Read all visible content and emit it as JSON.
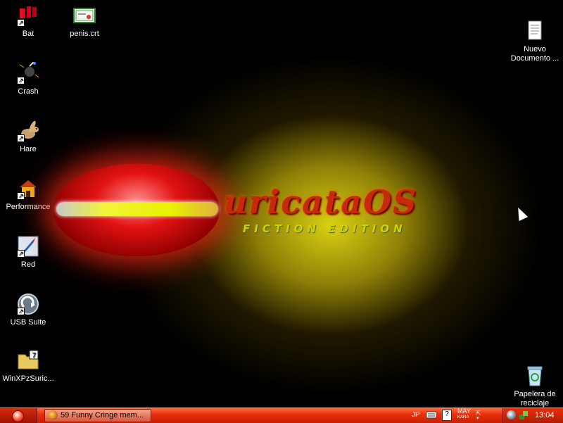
{
  "desktop": {
    "icons": [
      {
        "label": "Bat",
        "icon": "bat-icon"
      },
      {
        "label": "penis.crt",
        "icon": "certificate-icon"
      },
      {
        "label": "Crash",
        "icon": "crash-icon"
      },
      {
        "label": "Hare",
        "icon": "hare-icon"
      },
      {
        "label": "Performance",
        "icon": "performance-icon"
      },
      {
        "label": "Red",
        "icon": "rocket-icon"
      },
      {
        "label": "USB Suite",
        "icon": "usb-suite-icon"
      },
      {
        "label": "WinXPzSuric...",
        "icon": "folder-icon"
      },
      {
        "label": "Nuevo\nDocumento ...",
        "icon": "document-icon"
      },
      {
        "label": "Papelera de\nreciclaje",
        "icon": "recycle-bin-icon"
      }
    ],
    "wallpaper": {
      "logo_text": "uricataOS",
      "logo_subtext": "FICTION EDITION"
    }
  },
  "taskbar": {
    "task_button_label": "59 Funny Cringe mem...",
    "lang": "JP",
    "ime_mode_top": "MAY",
    "ime_mode_bottom": "KANA",
    "clock": "13:04"
  },
  "colors": {
    "taskbar": "#e8310c",
    "glow": "#e6dc14",
    "logo_red": "#c62a0a"
  }
}
